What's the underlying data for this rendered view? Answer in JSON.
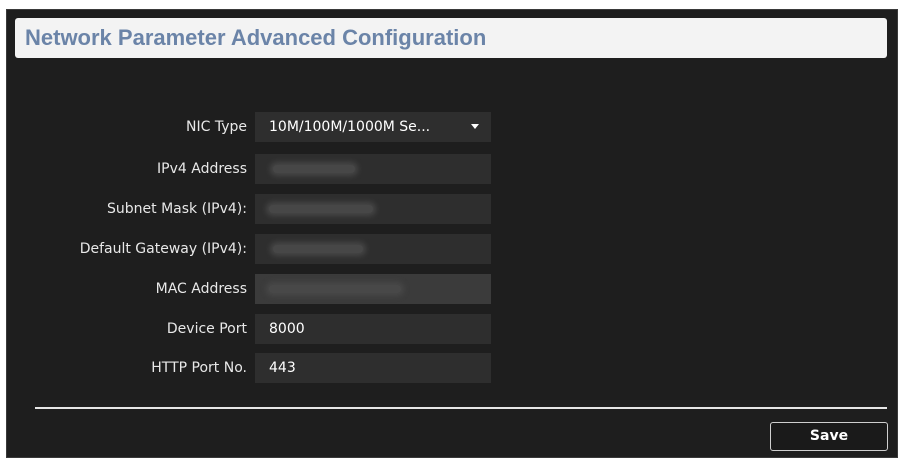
{
  "header": {
    "title": "Network Parameter Advanced Configuration"
  },
  "form": {
    "nic_type": {
      "label": "NIC Type",
      "value": "10M/100M/1000M Se..."
    },
    "ipv4_address": {
      "label": "IPv4 Address"
    },
    "subnet_mask": {
      "label": "Subnet Mask (IPv4):"
    },
    "default_gateway": {
      "label": "Default Gateway (IPv4):"
    },
    "mac_address": {
      "label": "MAC Address"
    },
    "device_port": {
      "label": "Device Port",
      "value": "8000"
    },
    "http_port": {
      "label": "HTTP Port No.",
      "value": "443"
    }
  },
  "footer": {
    "save_label": "Save"
  },
  "icons": {
    "dropdown": "chevron-down-icon"
  },
  "colors": {
    "panel_bg": "#1e1e1e",
    "field_bg": "#2e2e2e",
    "header_bg": "#f3f3f3",
    "title_color": "#6b84a8"
  }
}
